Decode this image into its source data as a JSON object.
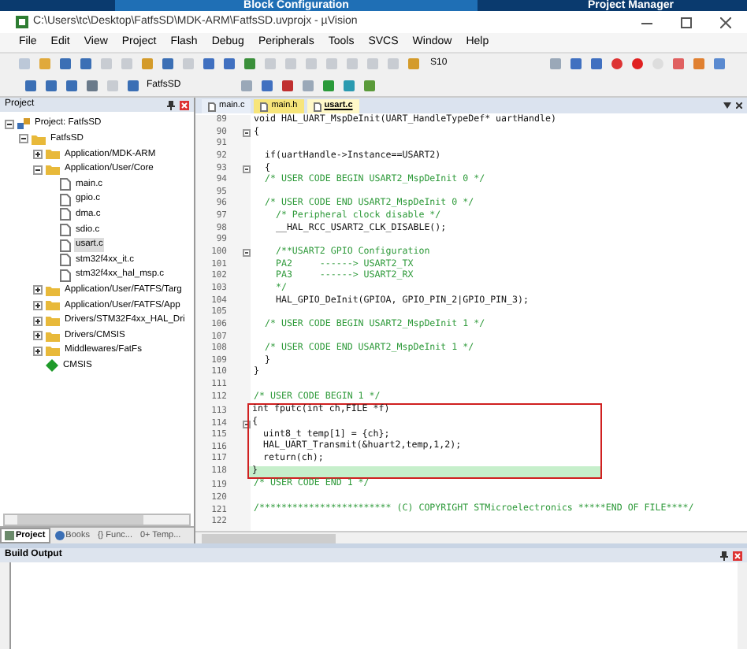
{
  "background_tabs": [
    "Block Configuration",
    "Project Manager"
  ],
  "window": {
    "title": "C:\\Users\\tc\\Desktop\\FatfsSD\\MDK-ARM\\FatfsSD.uvprojx - µVision"
  },
  "menu": [
    "File",
    "Edit",
    "View",
    "Project",
    "Flash",
    "Debug",
    "Peripherals",
    "Tools",
    "SVCS",
    "Window",
    "Help"
  ],
  "toolbar": {
    "find_value": "S10",
    "target": "FatfsSD"
  },
  "project_panel": {
    "title": "Project",
    "tree": [
      {
        "label": "Project: FatfsSD",
        "kind": "project",
        "expanded": true,
        "selected": false,
        "children": [
          {
            "label": "FatfsSD",
            "kind": "folder",
            "expanded": true,
            "selected": false,
            "children": [
              {
                "label": "Application/MDK-ARM",
                "kind": "folder",
                "expanded": false,
                "selected": false
              },
              {
                "label": "Application/User/Core",
                "kind": "folder",
                "expanded": true,
                "selected": false,
                "children": [
                  {
                    "label": "main.c",
                    "kind": "file",
                    "selected": false
                  },
                  {
                    "label": "gpio.c",
                    "kind": "file",
                    "selected": false
                  },
                  {
                    "label": "dma.c",
                    "kind": "file",
                    "selected": false
                  },
                  {
                    "label": "sdio.c",
                    "kind": "file",
                    "selected": false
                  },
                  {
                    "label": "usart.c",
                    "kind": "file",
                    "selected": true
                  },
                  {
                    "label": "stm32f4xx_it.c",
                    "kind": "file",
                    "selected": false
                  },
                  {
                    "label": "stm32f4xx_hal_msp.c",
                    "kind": "file",
                    "selected": false
                  }
                ]
              },
              {
                "label": "Application/User/FATFS/Targ",
                "kind": "folder",
                "expanded": false,
                "selected": false
              },
              {
                "label": "Application/User/FATFS/App",
                "kind": "folder",
                "expanded": false,
                "selected": false
              },
              {
                "label": "Drivers/STM32F4xx_HAL_Dri",
                "kind": "folder",
                "expanded": false,
                "selected": false
              },
              {
                "label": "Drivers/CMSIS",
                "kind": "folder",
                "expanded": false,
                "selected": false
              },
              {
                "label": "Middlewares/FatFs",
                "kind": "folder",
                "expanded": false,
                "selected": false
              },
              {
                "label": "CMSIS",
                "kind": "component",
                "selected": false
              }
            ]
          }
        ]
      }
    ],
    "tabs": [
      {
        "label": "Project",
        "kind": "project",
        "selected": true
      },
      {
        "label": "Books",
        "kind": "books",
        "selected": false
      },
      {
        "label": "{} Func...",
        "kind": "plain",
        "selected": false
      },
      {
        "label": "0+ Temp...",
        "kind": "plain",
        "selected": false
      }
    ]
  },
  "editor": {
    "tabs": [
      {
        "label": "main.c",
        "selected": false,
        "modified": false
      },
      {
        "label": "main.h",
        "selected": false,
        "modified": true
      },
      {
        "label": "usart.c",
        "selected": true,
        "modified": false
      }
    ],
    "lines": [
      {
        "number": "89",
        "text": "void HAL_UART_MspDeInit(UART_HandleTypeDef* uartHandle)",
        "kind": "code"
      },
      {
        "number": "90",
        "text": "{",
        "kind": "code",
        "fold": true
      },
      {
        "number": "91"
      },
      {
        "number": "92",
        "text": "  if(uartHandle->Instance==USART2)",
        "kind": "code"
      },
      {
        "number": "93",
        "text": "  {",
        "kind": "code",
        "fold": true
      },
      {
        "number": "94",
        "text": "  /* USER CODE BEGIN USART2_MspDeInit 0 */",
        "kind": "comment"
      },
      {
        "number": "95"
      },
      {
        "number": "96",
        "text": "  /* USER CODE END USART2_MspDeInit 0 */",
        "kind": "comment"
      },
      {
        "number": "97",
        "text": "    /* Peripheral clock disable */",
        "kind": "comment"
      },
      {
        "number": "98",
        "text": "    __HAL_RCC_USART2_CLK_DISABLE();",
        "kind": "code"
      },
      {
        "number": "99"
      },
      {
        "number": "100",
        "text": "    /**USART2 GPIO Configuration",
        "kind": "comment",
        "fold": true
      },
      {
        "number": "101",
        "text": "    PA2     ------> USART2_TX",
        "kind": "comment"
      },
      {
        "number": "102",
        "text": "    PA3     ------> USART2_RX",
        "kind": "comment"
      },
      {
        "number": "103",
        "text": "    */",
        "kind": "comment"
      },
      {
        "number": "104",
        "text": "    HAL_GPIO_DeInit(GPIOA, GPIO_PIN_2|GPIO_PIN_3);",
        "kind": "code"
      },
      {
        "number": "105"
      },
      {
        "number": "106",
        "text": "  /* USER CODE BEGIN USART2_MspDeInit 1 */",
        "kind": "comment"
      },
      {
        "number": "107"
      },
      {
        "number": "108",
        "text": "  /* USER CODE END USART2_MspDeInit 1 */",
        "kind": "comment"
      },
      {
        "number": "109",
        "text": "  }",
        "kind": "code"
      },
      {
        "number": "110",
        "text": "}",
        "kind": "code"
      },
      {
        "number": "111"
      },
      {
        "number": "112",
        "text": "/* USER CODE BEGIN 1 */",
        "kind": "comment"
      }
    ],
    "highlight_frame": {
      "lines": [
        {
          "number": "113",
          "text": "int fputc(int ch,FILE *f)",
          "kind": "code"
        },
        {
          "number": "114",
          "text": "{",
          "kind": "code",
          "fold": true
        },
        {
          "number": "115",
          "text": "  uint8_t temp[1] = {ch};",
          "kind": "code"
        },
        {
          "number": "116",
          "text": "  HAL_UART_Transmit(&huart2,temp,1,2);",
          "kind": "code"
        },
        {
          "number": "117",
          "text": "  return(ch);",
          "kind": "code"
        },
        {
          "number": "118",
          "text": "}",
          "kind": "code",
          "current": true
        }
      ]
    },
    "lines_after": [
      {
        "number": "119",
        "text": "/* USER CODE END 1 */",
        "kind": "comment"
      },
      {
        "number": "120"
      },
      {
        "number": "121",
        "text": "/************************ (C) COPYRIGHT STMicroelectronics *****END OF FILE****/",
        "kind": "comment"
      },
      {
        "number": "122"
      }
    ]
  },
  "build_output": {
    "title": "Build Output"
  }
}
